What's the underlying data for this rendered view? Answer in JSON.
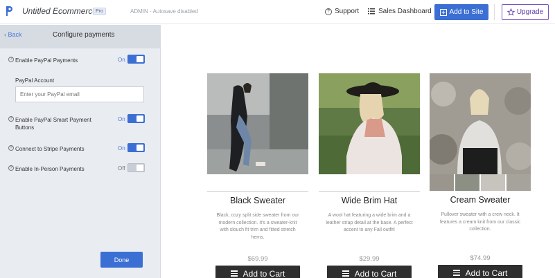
{
  "header": {
    "app_title": "Untitled Ecommerce",
    "badge": "Pro",
    "status": "ADMIN - Autosave disabled",
    "support_label": "Support",
    "dashboard_label": "Sales Dashboard",
    "add_site_label": "Add to Site",
    "upgrade_label": "Upgrade"
  },
  "sidebar": {
    "back_label": "Back",
    "title": "Configure payments",
    "settings": [
      {
        "label": "Enable PayPal Payments",
        "state": "On"
      },
      {
        "label": "Enable PayPal Smart Payment Buttons",
        "state": "On"
      },
      {
        "label": "Connect to Stripe Payments",
        "state": "On"
      },
      {
        "label": "Enable In-Person Payments",
        "state": "Off"
      }
    ],
    "paypal_account_label": "PayPal Account",
    "paypal_account_placeholder": "Enter your PayPal email",
    "done_label": "Done"
  },
  "products": [
    {
      "name": "Black Sweater",
      "description": "Black, cozy split side sweater from our modern collection. It's a sweater-knit with slouch fit trim and fitted stretch hems.",
      "price": "$69.99",
      "cart_label": "Add to Cart"
    },
    {
      "name": "Wide Brim Hat",
      "description": "A wool hat featuring a wide brim and a leather strap detail at the base. A perfect accent to any Fall outfit!",
      "price": "$29.99",
      "cart_label": "Add to Cart"
    },
    {
      "name": "Cream Sweater",
      "description": "Pullover sweater with a crew neck. It features a cream knit from our classic collection.",
      "price": "$74.99",
      "cart_label": "Add to Cart"
    }
  ],
  "colors": {
    "accent": "#3b6fd4",
    "upgrade": "#7a52c7",
    "sidebar_bg": "#e9ecf1",
    "cart_button": "#2f2f2f"
  }
}
